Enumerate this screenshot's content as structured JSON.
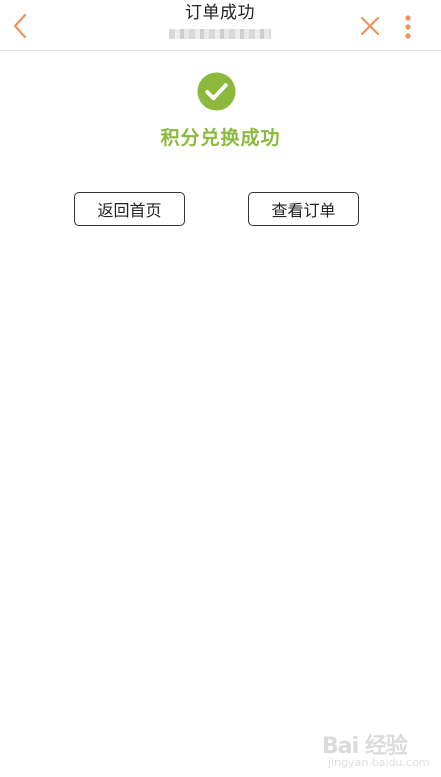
{
  "header": {
    "title": "订单成功",
    "back_icon": "chevron-left-icon",
    "close_icon": "close-icon",
    "more_icon": "more-vertical-icon",
    "accent_color": "#f0905a"
  },
  "success": {
    "icon": "check-circle-icon",
    "message": "积分兑换成功",
    "color": "#8cb83c"
  },
  "actions": {
    "home_label": "返回首页",
    "order_label": "查看订单"
  },
  "watermark": {
    "brand": "Bai 经验",
    "url": "jingyan.baidu.com"
  }
}
